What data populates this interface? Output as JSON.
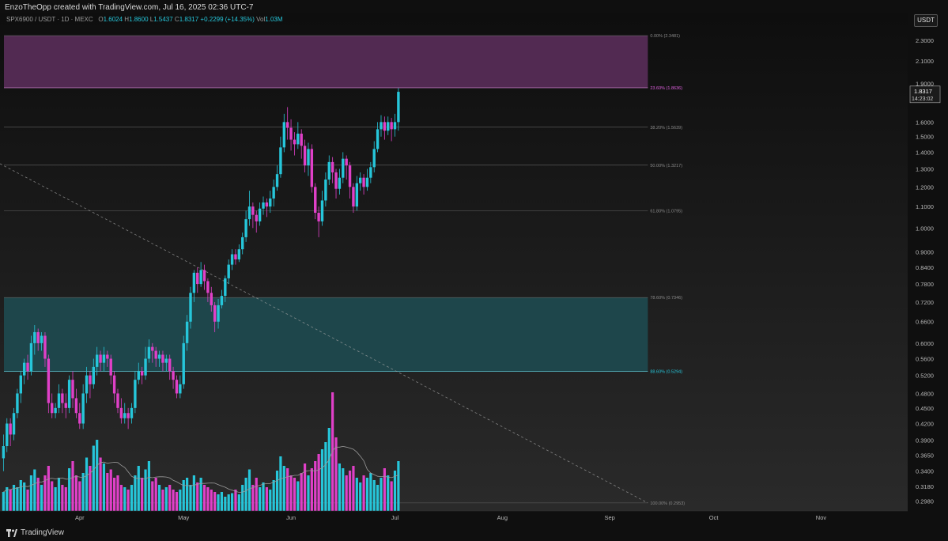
{
  "caption": "EnzoTheOpp created with TradingView.com, Jul 16, 2025 02:36 UTC-7",
  "legend": {
    "symbol": "SPX6900 / USDT · 1D · MEXC",
    "o_label": "O",
    "o": "1.6024",
    "h_label": "H",
    "h": "1.8600",
    "l_label": "L",
    "l": "1.5437",
    "c_label": "C",
    "c": "1.8317",
    "change": "+0.2299 (+14.35%)",
    "vol_label": "Vol",
    "vol": "1.03M"
  },
  "currency_label": "USDT",
  "brand": "TradingView",
  "icons": [
    "tradingview-logo-icon"
  ],
  "colors": {
    "up": "#26c6da",
    "down": "#e040c8",
    "supply_zone": "#5a2d5a",
    "demand_zone": "#1e4a50",
    "price_badge": "#26c6da"
  },
  "chart_data": {
    "type": "candlestick",
    "pair": "SPX6900/USDT",
    "timeframe": "1D",
    "y_scale": "log",
    "ylim": [
      0.285,
      2.6
    ],
    "y_ticks": [
      "2.3000",
      "2.1000",
      "1.9000",
      "1.6000",
      "1.5000",
      "1.4000",
      "1.3000",
      "1.2000",
      "1.1000",
      "1.0000",
      "0.9000",
      "0.8400",
      "0.7800",
      "0.7200",
      "0.6600",
      "0.6000",
      "0.5600",
      "0.5200",
      "0.4800",
      "0.4500",
      "0.4200",
      "0.3900",
      "0.3650",
      "0.3400",
      "0.3180",
      "0.2980"
    ],
    "x_ticks": [
      "Apr",
      "May",
      "Jun",
      "Jul",
      "Aug",
      "Sep",
      "Oct",
      "Nov"
    ],
    "x_range_days": [
      0,
      262
    ],
    "x_tick_days": [
      23,
      53,
      84,
      114,
      145,
      176,
      206,
      237
    ],
    "current_price": "1.8317",
    "countdown": "14:23:02",
    "fib_levels": [
      {
        "label": "0.00% (2.3481)",
        "value": 2.3481
      },
      {
        "label": "23.60% (1.8636)",
        "value": 1.8636
      },
      {
        "label": "38.20% (1.5639)",
        "value": 1.5639
      },
      {
        "label": "50.00% (1.3217)",
        "value": 1.3217
      },
      {
        "label": "61.80% (1.0795)",
        "value": 1.0795
      },
      {
        "label": "78.60% (0.7346)",
        "value": 0.7346
      },
      {
        "label": "88.60% (0.5294)",
        "value": 0.5294
      },
      {
        "label": "100.00% (0.2953)",
        "value": 0.2953
      }
    ],
    "zones": [
      {
        "name": "upper",
        "from": 1.8636,
        "to": 2.3481,
        "end_day": 187
      },
      {
        "name": "lower",
        "from": 0.5294,
        "to": 0.7346,
        "end_day": 187
      }
    ],
    "trendline": {
      "start": [
        0,
        1.33
      ],
      "end": [
        187,
        0.2953
      ]
    },
    "candles": [
      [
        0.36,
        0.38,
        0.34,
        0.4
      ],
      [
        0.38,
        0.42,
        0.37,
        0.43
      ],
      [
        0.42,
        0.4,
        0.38,
        0.43
      ],
      [
        0.4,
        0.44,
        0.39,
        0.45
      ],
      [
        0.44,
        0.48,
        0.43,
        0.49
      ],
      [
        0.48,
        0.52,
        0.46,
        0.53
      ],
      [
        0.52,
        0.55,
        0.5,
        0.56
      ],
      [
        0.55,
        0.53,
        0.51,
        0.57
      ],
      [
        0.53,
        0.6,
        0.52,
        0.62
      ],
      [
        0.6,
        0.63,
        0.57,
        0.65
      ],
      [
        0.63,
        0.6,
        0.58,
        0.64
      ],
      [
        0.6,
        0.62,
        0.58,
        0.63
      ],
      [
        0.62,
        0.56,
        0.54,
        0.63
      ],
      [
        0.56,
        0.46,
        0.44,
        0.57
      ],
      [
        0.46,
        0.44,
        0.43,
        0.48
      ],
      [
        0.44,
        0.45,
        0.43,
        0.46
      ],
      [
        0.45,
        0.48,
        0.44,
        0.5
      ],
      [
        0.48,
        0.46,
        0.44,
        0.49
      ],
      [
        0.46,
        0.45,
        0.43,
        0.48
      ],
      [
        0.45,
        0.51,
        0.44,
        0.52
      ],
      [
        0.51,
        0.47,
        0.45,
        0.53
      ],
      [
        0.47,
        0.44,
        0.43,
        0.49
      ],
      [
        0.44,
        0.42,
        0.41,
        0.46
      ],
      [
        0.42,
        0.48,
        0.41,
        0.5
      ],
      [
        0.48,
        0.52,
        0.46,
        0.54
      ],
      [
        0.52,
        0.5,
        0.47,
        0.53
      ],
      [
        0.5,
        0.54,
        0.49,
        0.56
      ],
      [
        0.54,
        0.57,
        0.52,
        0.59
      ],
      [
        0.57,
        0.55,
        0.53,
        0.58
      ],
      [
        0.55,
        0.57,
        0.53,
        0.59
      ],
      [
        0.57,
        0.56,
        0.54,
        0.58
      ],
      [
        0.56,
        0.52,
        0.5,
        0.57
      ],
      [
        0.52,
        0.48,
        0.46,
        0.53
      ],
      [
        0.48,
        0.45,
        0.44,
        0.49
      ],
      [
        0.45,
        0.43,
        0.42,
        0.47
      ],
      [
        0.43,
        0.44,
        0.42,
        0.46
      ],
      [
        0.44,
        0.43,
        0.41,
        0.45
      ],
      [
        0.43,
        0.45,
        0.42,
        0.46
      ],
      [
        0.45,
        0.51,
        0.44,
        0.53
      ],
      [
        0.51,
        0.53,
        0.5,
        0.55
      ],
      [
        0.53,
        0.52,
        0.5,
        0.54
      ],
      [
        0.52,
        0.56,
        0.51,
        0.59
      ],
      [
        0.56,
        0.59,
        0.55,
        0.61
      ],
      [
        0.59,
        0.58,
        0.55,
        0.6
      ],
      [
        0.58,
        0.56,
        0.54,
        0.59
      ],
      [
        0.56,
        0.57,
        0.54,
        0.58
      ],
      [
        0.57,
        0.55,
        0.53,
        0.58
      ],
      [
        0.55,
        0.56,
        0.53,
        0.57
      ],
      [
        0.56,
        0.53,
        0.51,
        0.57
      ],
      [
        0.53,
        0.51,
        0.49,
        0.54
      ],
      [
        0.51,
        0.48,
        0.47,
        0.52
      ],
      [
        0.48,
        0.5,
        0.47,
        0.52
      ],
      [
        0.5,
        0.6,
        0.49,
        0.62
      ],
      [
        0.6,
        0.66,
        0.58,
        0.68
      ],
      [
        0.66,
        0.75,
        0.64,
        0.77
      ],
      [
        0.75,
        0.82,
        0.72,
        0.83
      ],
      [
        0.82,
        0.78,
        0.75,
        0.84
      ],
      [
        0.78,
        0.83,
        0.77,
        0.86
      ],
      [
        0.83,
        0.79,
        0.76,
        0.85
      ],
      [
        0.79,
        0.75,
        0.72,
        0.8
      ],
      [
        0.75,
        0.71,
        0.69,
        0.77
      ],
      [
        0.71,
        0.66,
        0.63,
        0.72
      ],
      [
        0.66,
        0.71,
        0.64,
        0.73
      ],
      [
        0.71,
        0.74,
        0.7,
        0.76
      ],
      [
        0.74,
        0.8,
        0.72,
        0.81
      ],
      [
        0.8,
        0.85,
        0.78,
        0.87
      ],
      [
        0.85,
        0.89,
        0.83,
        0.91
      ],
      [
        0.89,
        0.87,
        0.85,
        0.91
      ],
      [
        0.87,
        0.91,
        0.86,
        0.93
      ],
      [
        0.91,
        0.96,
        0.89,
        0.98
      ],
      [
        0.96,
        1.04,
        0.94,
        1.08
      ],
      [
        1.04,
        1.1,
        1.01,
        1.18
      ],
      [
        1.1,
        1.06,
        1.0,
        1.12
      ],
      [
        1.06,
        1.03,
        0.98,
        1.08
      ],
      [
        1.03,
        1.09,
        1.01,
        1.12
      ],
      [
        1.09,
        1.12,
        1.06,
        1.15
      ],
      [
        1.12,
        1.1,
        1.05,
        1.14
      ],
      [
        1.1,
        1.14,
        1.07,
        1.18
      ],
      [
        1.14,
        1.2,
        1.1,
        1.24
      ],
      [
        1.2,
        1.27,
        1.18,
        1.32
      ],
      [
        1.27,
        1.43,
        1.25,
        1.5
      ],
      [
        1.43,
        1.6,
        1.4,
        1.66
      ],
      [
        1.6,
        1.56,
        1.48,
        1.71
      ],
      [
        1.56,
        1.48,
        1.41,
        1.62
      ],
      [
        1.48,
        1.45,
        1.38,
        1.53
      ],
      [
        1.45,
        1.52,
        1.42,
        1.6
      ],
      [
        1.52,
        1.44,
        1.36,
        1.55
      ],
      [
        1.44,
        1.32,
        1.28,
        1.48
      ],
      [
        1.32,
        1.42,
        1.26,
        1.46
      ],
      [
        1.42,
        1.2,
        1.17,
        1.45
      ],
      [
        1.2,
        1.07,
        1.04,
        1.22
      ],
      [
        1.07,
        1.03,
        0.96,
        1.1
      ],
      [
        1.03,
        1.13,
        1.01,
        1.18
      ],
      [
        1.13,
        1.24,
        1.1,
        1.28
      ],
      [
        1.24,
        1.34,
        1.21,
        1.38
      ],
      [
        1.34,
        1.28,
        1.22,
        1.37
      ],
      [
        1.28,
        1.19,
        1.14,
        1.3
      ],
      [
        1.19,
        1.25,
        1.16,
        1.3
      ],
      [
        1.25,
        1.36,
        1.22,
        1.4
      ],
      [
        1.36,
        1.32,
        1.24,
        1.38
      ],
      [
        1.32,
        1.2,
        1.14,
        1.34
      ],
      [
        1.2,
        1.1,
        1.07,
        1.22
      ],
      [
        1.1,
        1.22,
        1.08,
        1.26
      ],
      [
        1.22,
        1.25,
        1.18,
        1.28
      ],
      [
        1.25,
        1.2,
        1.16,
        1.27
      ],
      [
        1.2,
        1.25,
        1.18,
        1.3
      ],
      [
        1.25,
        1.31,
        1.22,
        1.34
      ],
      [
        1.31,
        1.42,
        1.28,
        1.47
      ],
      [
        1.42,
        1.55,
        1.4,
        1.6
      ],
      [
        1.55,
        1.6,
        1.5,
        1.65
      ],
      [
        1.6,
        1.54,
        1.48,
        1.64
      ],
      [
        1.54,
        1.6,
        1.51,
        1.64
      ],
      [
        1.6,
        1.55,
        1.47,
        1.63
      ],
      [
        1.55,
        1.6,
        1.5,
        1.66
      ],
      [
        1.6,
        1.83,
        1.54,
        1.86
      ]
    ],
    "volume": [
      0.16,
      0.2,
      0.18,
      0.22,
      0.2,
      0.26,
      0.24,
      0.18,
      0.3,
      0.35,
      0.28,
      0.22,
      0.3,
      0.38,
      0.25,
      0.2,
      0.28,
      0.22,
      0.2,
      0.36,
      0.42,
      0.3,
      0.25,
      0.32,
      0.45,
      0.38,
      0.55,
      0.6,
      0.45,
      0.4,
      0.32,
      0.35,
      0.28,
      0.3,
      0.22,
      0.2,
      0.18,
      0.22,
      0.3,
      0.38,
      0.28,
      0.35,
      0.42,
      0.25,
      0.28,
      0.22,
      0.18,
      0.2,
      0.22,
      0.18,
      0.16,
      0.18,
      0.26,
      0.28,
      0.22,
      0.3,
      0.24,
      0.28,
      0.22,
      0.2,
      0.18,
      0.16,
      0.14,
      0.16,
      0.12,
      0.14,
      0.15,
      0.18,
      0.14,
      0.22,
      0.28,
      0.35,
      0.22,
      0.28,
      0.2,
      0.24,
      0.2,
      0.18,
      0.26,
      0.34,
      0.46,
      0.38,
      0.36,
      0.3,
      0.28,
      0.25,
      0.32,
      0.4,
      0.3,
      0.36,
      0.42,
      0.48,
      0.52,
      0.58,
      0.7,
      1.0,
      0.62,
      0.4,
      0.36,
      0.3,
      0.34,
      0.38,
      0.28,
      0.24,
      0.3,
      0.28,
      0.32,
      0.26,
      0.22,
      0.28,
      0.36,
      0.3,
      0.25,
      0.34,
      0.42,
      0.3,
      0.32,
      0.28,
      0.3,
      0.32,
      0.2
    ]
  }
}
